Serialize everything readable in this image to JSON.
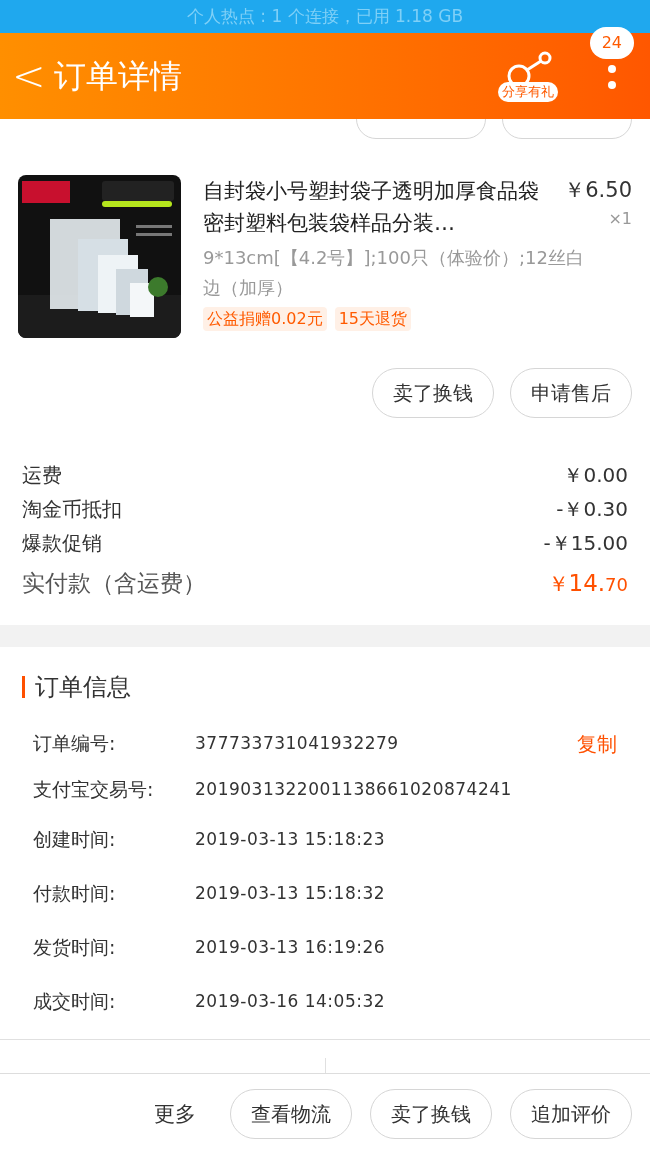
{
  "status_bar": {
    "text": "个人热点 : 1 个连接，已用 1.18 GB"
  },
  "header": {
    "back": "<",
    "title": "订单详情",
    "share_label": "分享有礼",
    "badge": "24"
  },
  "product": {
    "title": "自封袋小号塑封袋子透明加厚食品袋密封塑料包装袋样品分装…",
    "price": "￥6.50",
    "quantity": "×1",
    "sku": "9*13cm[【4.2号】];100只（体验价）;12丝白边（加厚）",
    "tags": [
      "公益捐赠0.02元",
      "15天退货"
    ],
    "buttons": [
      "卖了换钱",
      "申请售后"
    ]
  },
  "fees": [
    {
      "label": "运费",
      "value": "￥0.00"
    },
    {
      "label": "淘金币抵扣",
      "value": "-￥0.30"
    },
    {
      "label": "爆款促销",
      "value": "-￥15.00"
    }
  ],
  "total": {
    "label": "实付款（含运费）",
    "currency": "￥",
    "integer": "14.",
    "decimal": "70"
  },
  "order_info": {
    "title": "订单信息",
    "copy": "复制",
    "rows": [
      {
        "label": "订单编号:",
        "value": "377733731041932279"
      },
      {
        "label": "支付宝交易号:",
        "value": "2019031322001138661020874241"
      },
      {
        "label": "创建时间:",
        "value": "2019-03-13 15:18:23"
      },
      {
        "label": "付款时间:",
        "value": "2019-03-13 15:18:32"
      },
      {
        "label": "发货时间:",
        "value": "2019-03-13 16:19:26"
      },
      {
        "label": "成交时间:",
        "value": "2019-03-16 14:05:32"
      }
    ]
  },
  "bottom_bar": {
    "more": "更多",
    "buttons": [
      "查看物流",
      "卖了换钱",
      "追加评价"
    ]
  }
}
